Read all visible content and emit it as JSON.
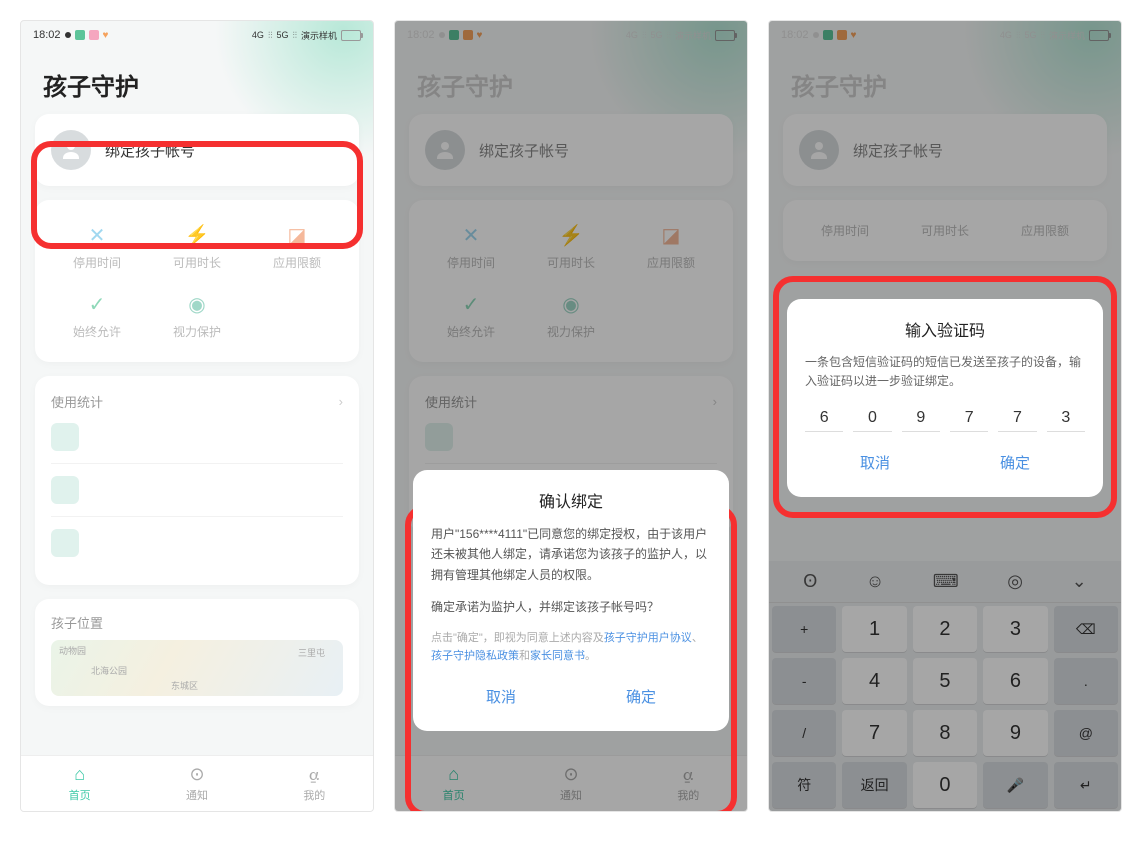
{
  "status": {
    "time": "18:02",
    "carrier": "演示样机",
    "net1": "4G",
    "net2": "5G"
  },
  "page_title": "孩子守护",
  "bind_label": "绑定孩子帐号",
  "grid": [
    {
      "label": "停用时间",
      "color": "#5dc9f5"
    },
    {
      "label": "可用时长",
      "color": "#5da6f5"
    },
    {
      "label": "应用限额",
      "color": "#f5a25d"
    },
    {
      "label": "始终允许",
      "color": "#5dc49a"
    },
    {
      "label": "视力保护",
      "color": "#5dc49a"
    }
  ],
  "stats_hdr": "使用统计",
  "location_hdr": "孩子位置",
  "map_labels": {
    "a": "动物园",
    "b": "北海公园",
    "c": "三里屯",
    "d": "东城区"
  },
  "tabs": [
    {
      "label": "首页"
    },
    {
      "label": "通知"
    },
    {
      "label": "我的"
    }
  ],
  "confirm": {
    "title": "确认绑定",
    "body1": "用户\"156****4111\"已同意您的绑定授权，由于该用户还未被其他人绑定，请承诺您为该孩子的监护人，以拥有管理其他绑定人员的权限。",
    "body2": "确定承诺为监护人，并绑定该孩子帐号吗？",
    "fine": "点击\"确定\"，即视为同意上述内容及",
    "link1": "孩子守护用户协议",
    "link2": "孩子守护隐私政策",
    "link3": "家长同意书",
    "cancel": "取消",
    "ok": "确定"
  },
  "code": {
    "title": "输入验证码",
    "desc": "一条包含短信验证码的短信已发送至孩子的设备，输入验证码以进一步验证绑定。",
    "digits": [
      "6",
      "0",
      "9",
      "7",
      "7",
      "3"
    ],
    "cancel": "取消",
    "ok": "确定"
  },
  "keys": {
    "row1": [
      "+",
      "1",
      "2",
      "3",
      "⌫"
    ],
    "row2": [
      "-",
      "4",
      "5",
      "6",
      "."
    ],
    "row3": [
      "/",
      "7",
      "8",
      "9",
      "@"
    ],
    "row4": [
      "符",
      "返回",
      "0",
      "🎤",
      "↵"
    ]
  }
}
